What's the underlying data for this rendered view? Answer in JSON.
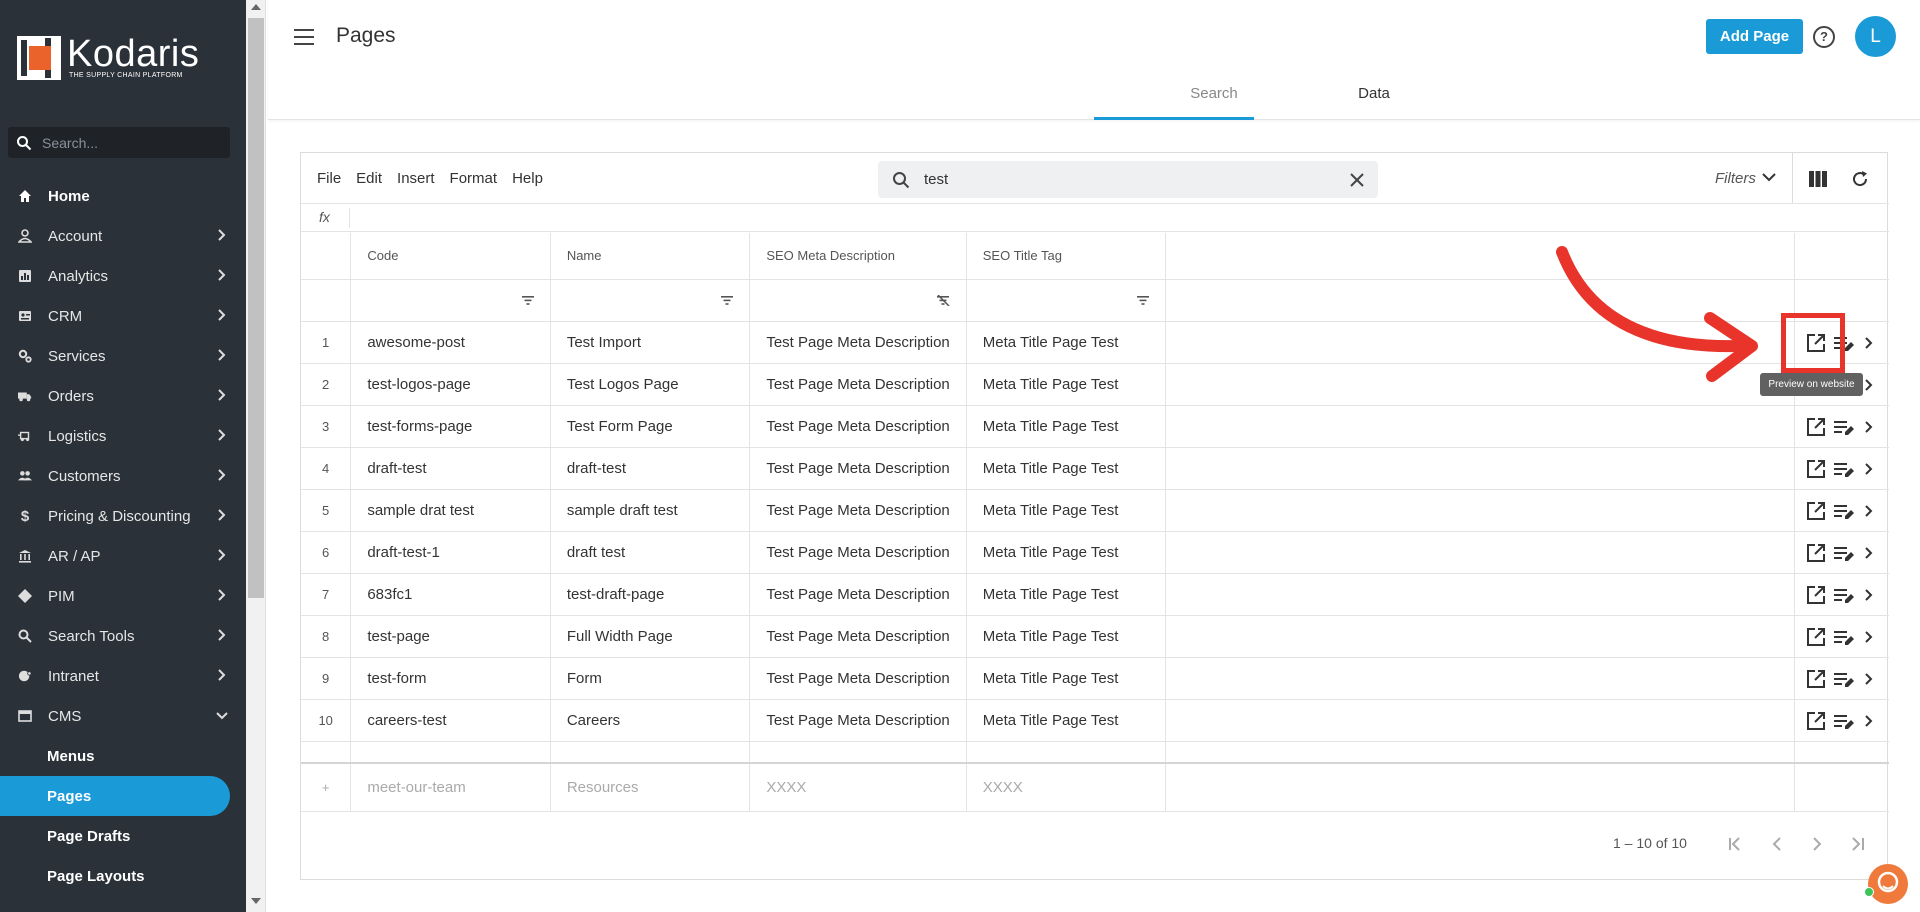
{
  "brand": {
    "name": "Kodaris",
    "tagline": "THE SUPPLY CHAIN PLATFORM"
  },
  "sidebar": {
    "search_placeholder": "Search...",
    "items": [
      {
        "label": "Home"
      },
      {
        "label": "Account"
      },
      {
        "label": "Analytics"
      },
      {
        "label": "CRM"
      },
      {
        "label": "Services"
      },
      {
        "label": "Orders"
      },
      {
        "label": "Logistics"
      },
      {
        "label": "Customers"
      },
      {
        "label": "Pricing & Discounting"
      },
      {
        "label": "AR / AP"
      },
      {
        "label": "PIM"
      },
      {
        "label": "Search Tools"
      },
      {
        "label": "Intranet"
      },
      {
        "label": "CMS"
      }
    ],
    "cms_sub": [
      {
        "label": "Menus"
      },
      {
        "label": "Pages"
      },
      {
        "label": "Page Drafts"
      },
      {
        "label": "Page Layouts"
      }
    ]
  },
  "header": {
    "title": "Pages",
    "add_label": "Add Page",
    "help": "?",
    "avatar": "L"
  },
  "tabs": [
    {
      "label": "Search"
    },
    {
      "label": "Data"
    }
  ],
  "grid": {
    "menu": [
      "File",
      "Edit",
      "Insert",
      "Format",
      "Help"
    ],
    "search_value": "test",
    "filters_label": "Filters",
    "fx_label": "fx",
    "columns": [
      "Code",
      "Name",
      "SEO Meta Description",
      "SEO Title Tag"
    ],
    "rows": [
      {
        "n": "1",
        "code": "awesome-post",
        "name": "Test Import",
        "meta": "Test Page Meta Description",
        "title": "Meta Title Page Test"
      },
      {
        "n": "2",
        "code": "test-logos-page",
        "name": "Test Logos Page",
        "meta": "Test Page Meta Description",
        "title": "Meta Title Page Test"
      },
      {
        "n": "3",
        "code": "test-forms-page",
        "name": "Test Form Page",
        "meta": "Test Page Meta Description",
        "title": "Meta Title Page Test"
      },
      {
        "n": "4",
        "code": "draft-test",
        "name": "draft-test",
        "meta": "Test Page Meta Description",
        "title": "Meta Title Page Test"
      },
      {
        "n": "5",
        "code": "sample drat test",
        "name": "sample draft test",
        "meta": "Test Page Meta Description",
        "title": "Meta Title Page Test"
      },
      {
        "n": "6",
        "code": "draft-test-1",
        "name": "draft test",
        "meta": "Test Page Meta Description",
        "title": "Meta Title Page Test"
      },
      {
        "n": "7",
        "code": "683fc1",
        "name": "test-draft-page",
        "meta": "Test Page Meta Description",
        "title": "Meta Title Page Test"
      },
      {
        "n": "8",
        "code": "test-page",
        "name": "Full Width Page",
        "meta": "Test Page Meta Description",
        "title": "Meta Title Page Test"
      },
      {
        "n": "9",
        "code": "test-form",
        "name": "Form",
        "meta": "Test Page Meta Description",
        "title": "Meta Title Page Test"
      },
      {
        "n": "10",
        "code": "careers-test",
        "name": "Careers",
        "meta": "Test Page Meta Description",
        "title": "Meta Title Page Test"
      }
    ],
    "new_row": {
      "code": "meet-our-team",
      "name": "Resources",
      "meta": "XXXX",
      "title": "XXXX"
    },
    "pagination": "1 – 10 of 10",
    "tooltip": "Preview on website"
  },
  "colors": {
    "accent": "#1a9bd7",
    "sidebar": "#2b3138",
    "annotation": "#e8342b"
  }
}
